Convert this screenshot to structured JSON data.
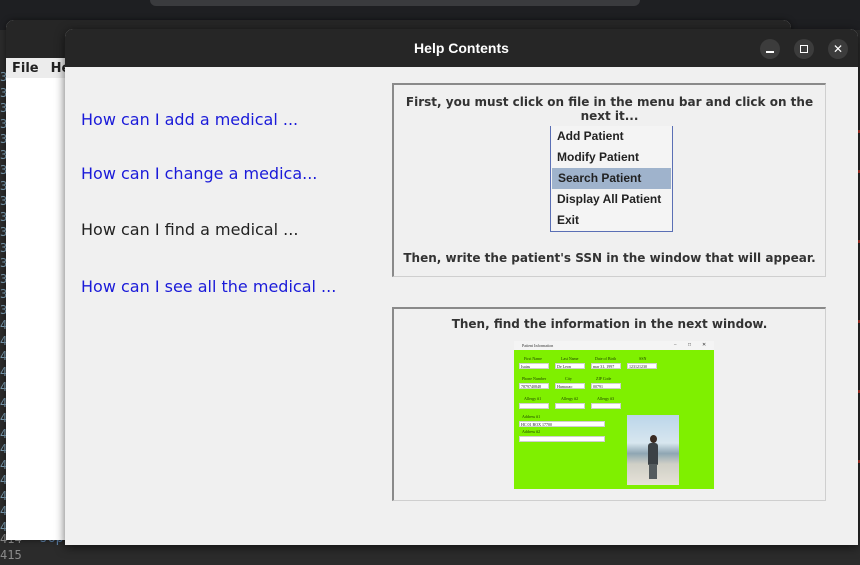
{
  "background_ide": {
    "gutter_digits": [
      "3",
      "3",
      "3",
      "3",
      "3",
      "3",
      "3",
      "3",
      "3",
      "3",
      "3",
      "3",
      "3",
      "3",
      "3",
      "3",
      "4",
      "4",
      "4",
      "4",
      "4",
      "4",
      "4",
      "4",
      "4",
      "4",
      "4",
      "4",
      "4",
      "4"
    ],
    "bottom_line_numbers": [
      "414",
      "415"
    ],
    "code_fragment": "Jop"
  },
  "back_window": {
    "menu": [
      "File",
      "He"
    ]
  },
  "help_window": {
    "title": "Help Contents",
    "topics": [
      {
        "label": "How can I add a medical ...",
        "is_link": true
      },
      {
        "label": "How can I change a medica...",
        "is_link": true
      },
      {
        "label": "How can I find a medical ...",
        "is_link": false
      },
      {
        "label": "How can I see all the medical ...",
        "is_link": true
      }
    ],
    "step1_text": "First, you must click on file  in the menu bar and click on the next it...",
    "menu_items": [
      "Add Patient",
      "Modify Patient",
      "Search Patient",
      "Display All Patient",
      "Exit"
    ],
    "selected_menu_item": "Search Patient",
    "step2_text": "Then, write the patient's SSN in the window that will appear.",
    "step3_text": "Then, find the information in the next window."
  },
  "patient_form": {
    "title": "Patient Information",
    "labels": [
      "First Name",
      "Last Name",
      "Date of Birth",
      "SSN",
      "Phone Number",
      "City",
      "ZIP Code",
      "Allergy #1",
      "Allergy #2",
      "Allergy #3",
      "Address #1",
      "Address #2"
    ],
    "first_name": "Isaias",
    "last_name": "De Leon",
    "date_of_birth": "mar 31, 1997",
    "ssn": "123121230",
    "phone": "7879740848",
    "city": "Humacao",
    "zip": "00791",
    "address1": "HC 01 BOX 17700"
  },
  "colors": {
    "link": "#1a1ad9",
    "form_background": "#7ff000",
    "menu_selected": "#9fb3cc"
  }
}
